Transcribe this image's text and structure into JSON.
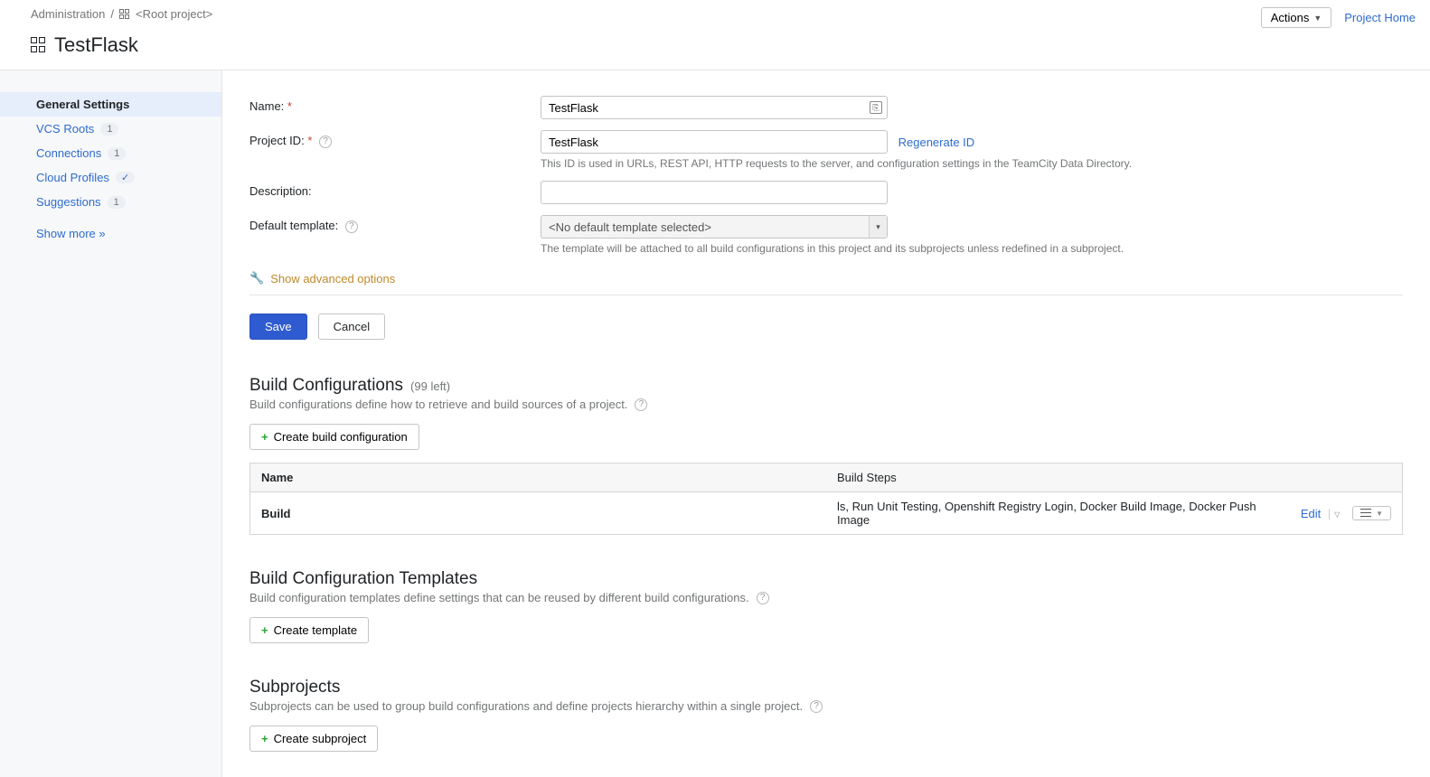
{
  "breadcrumb": {
    "admin": "Administration",
    "sep": "/",
    "root": "<Root project>"
  },
  "top": {
    "actions": "Actions",
    "project_home": "Project Home"
  },
  "title": "TestFlask",
  "sidebar": {
    "items": [
      {
        "label": "General Settings"
      },
      {
        "label": "VCS Roots",
        "badge": "1"
      },
      {
        "label": "Connections",
        "badge": "1"
      },
      {
        "label": "Cloud Profiles",
        "check": "✓"
      },
      {
        "label": "Suggestions",
        "badge": "1"
      }
    ],
    "show_more": "Show more »"
  },
  "form": {
    "name_label": "Name:",
    "name_value": "TestFlask",
    "project_id_label": "Project ID:",
    "project_id_value": "TestFlask",
    "regenerate": "Regenerate ID",
    "project_id_help": "This ID is used in URLs, REST API, HTTP requests to the server, and configuration settings in the TeamCity Data Directory.",
    "desc_label": "Description:",
    "desc_value": "",
    "template_label": "Default template:",
    "template_value": "<No default template selected>",
    "template_help": "The template will be attached to all build configurations in this project and its subprojects unless redefined in a subproject.",
    "advanced": "Show advanced options",
    "save": "Save",
    "cancel": "Cancel"
  },
  "build_configs": {
    "title": "Build Configurations",
    "left": "(99 left)",
    "desc": "Build configurations define how to retrieve and build sources of a project.",
    "create": "Create build configuration",
    "col_name": "Name",
    "col_steps": "Build Steps",
    "row_name": "Build",
    "row_steps": "ls, Run Unit Testing, Openshift Registry Login, Docker Build Image, Docker Push Image",
    "edit": "Edit"
  },
  "templates": {
    "title": "Build Configuration Templates",
    "desc": "Build configuration templates define settings that can be reused by different build configurations.",
    "create": "Create template"
  },
  "subprojects": {
    "title": "Subprojects",
    "desc": "Subprojects can be used to group build configurations and define projects hierarchy within a single project.",
    "create": "Create subproject"
  }
}
